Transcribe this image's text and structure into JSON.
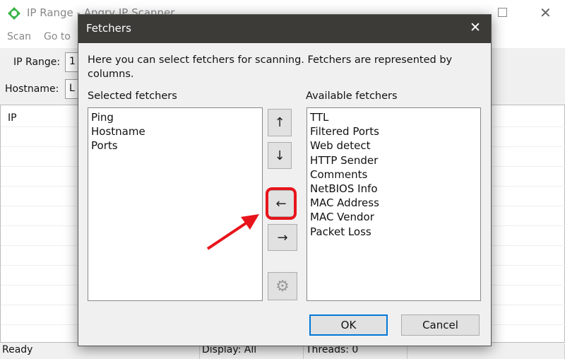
{
  "background_window": {
    "title": "IP Range - Angry IP Scanner",
    "menu": [
      "Scan",
      "Go to"
    ],
    "ip_range_label": "IP Range:",
    "ip_range_value": "1",
    "hostname_label": "Hostname:",
    "hostname_value": "L",
    "table_header": "IP",
    "status": {
      "state": "Ready",
      "display": "Display: All",
      "threads": "Threads: 0"
    }
  },
  "dialog": {
    "title": "Fetchers",
    "description": "Here you can select fetchers for scanning. Fetchers are represented by columns.",
    "selected_label": "Selected fetchers",
    "selected": [
      "Ping",
      "Hostname",
      "Ports"
    ],
    "available_label": "Available fetchers",
    "available": [
      "TTL",
      "Filtered Ports",
      "Web detect",
      "HTTP Sender",
      "Comments",
      "NetBIOS Info",
      "MAC Address",
      "MAC Vendor",
      "Packet Loss"
    ],
    "buttons": {
      "up": "↑",
      "down": "↓",
      "add": "←",
      "remove": "→",
      "ok": "OK",
      "cancel": "Cancel"
    },
    "highlight_color": "#e8141b"
  }
}
